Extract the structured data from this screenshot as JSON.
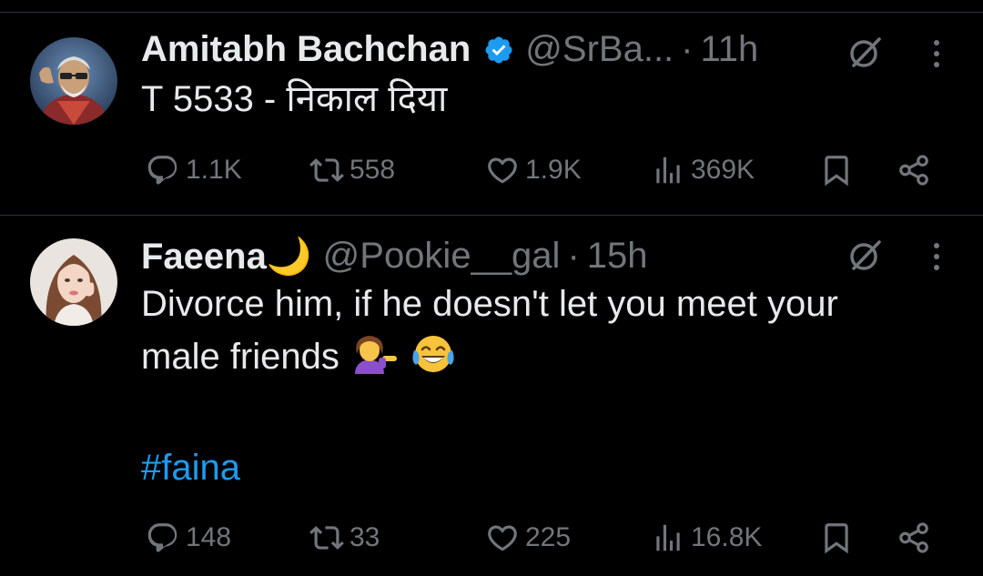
{
  "tweets": [
    {
      "name": "Amitabh Bachchan",
      "verified": true,
      "handle": "@SrBa...",
      "separator": "·",
      "time": "11h",
      "text": "T 5533 - निकाल दिया",
      "stats": {
        "replies": "1.1K",
        "reposts": "558",
        "likes": "1.9K",
        "views": "369K"
      }
    },
    {
      "name": "Faeena🌙",
      "verified": false,
      "handle": "@Pookie__gal",
      "separator": "·",
      "time": "15h",
      "text_line1": "Divorce him, if he doesn't let you meet your",
      "text_line2": "male friends",
      "hashtag": "#faina",
      "stats": {
        "replies": "148",
        "reposts": "33",
        "likes": "225",
        "views": "16.8K"
      }
    }
  ],
  "colors": {
    "background": "#000000",
    "text": "#e7e9ea",
    "muted": "#71767b",
    "accent": "#1d9bf0",
    "divider": "#2f3336"
  },
  "icons": [
    "avatar",
    "verified-badge-icon",
    "grok-icon",
    "more-icon",
    "reply-icon",
    "repost-icon",
    "like-icon",
    "views-icon",
    "bookmark-icon",
    "share-icon",
    "woman-tipping-hand-emoji",
    "tears-of-joy-emoji"
  ]
}
